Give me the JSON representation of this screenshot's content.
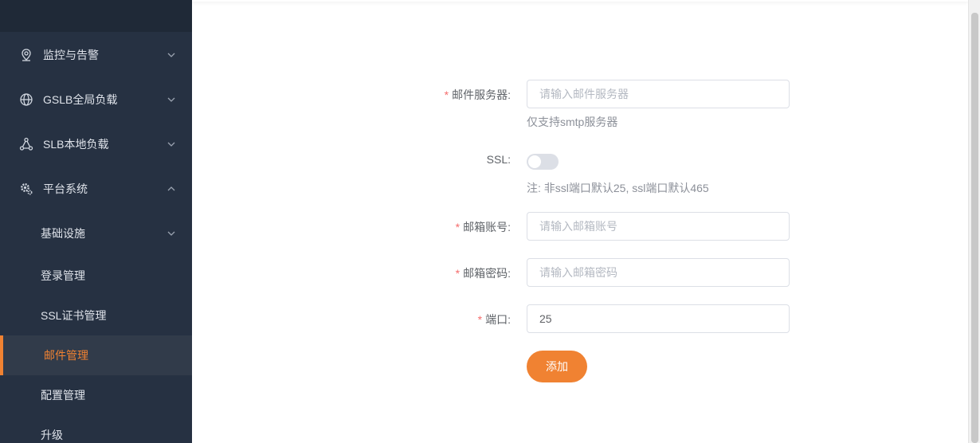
{
  "sidebar": {
    "menus": [
      {
        "label": "监控与告警",
        "icon": "location-pin-icon",
        "expanded": false
      },
      {
        "label": "GSLB全局负载",
        "icon": "globe-icon",
        "expanded": false
      },
      {
        "label": "SLB本地负载",
        "icon": "network-nodes-icon",
        "expanded": false
      },
      {
        "label": "平台系统",
        "icon": "gear-icon",
        "expanded": true
      }
    ],
    "submenus": [
      {
        "label": "基础设施",
        "has_children": true
      },
      {
        "label": "登录管理"
      },
      {
        "label": "SSL证书管理"
      },
      {
        "label": "邮件管理",
        "active": true
      },
      {
        "label": "配置管理"
      },
      {
        "label": "升级"
      }
    ],
    "accent_color": "#f08232"
  },
  "form": {
    "mail_server": {
      "label": "邮件服务器:",
      "placeholder": "请输入邮件服务器",
      "value": "",
      "hint": "仅支持smtp服务器"
    },
    "ssl": {
      "label": "SSL:",
      "enabled": false,
      "hint": "注: 非ssl端口默认25, ssl端口默认465"
    },
    "account": {
      "label": "邮箱账号:",
      "placeholder": "请输入邮箱账号",
      "value": ""
    },
    "password": {
      "label": "邮箱密码:",
      "placeholder": "请输入邮箱密码",
      "value": ""
    },
    "port": {
      "label": "端口:",
      "value": "25"
    },
    "required_mark": "*",
    "submit_label": "添加"
  }
}
